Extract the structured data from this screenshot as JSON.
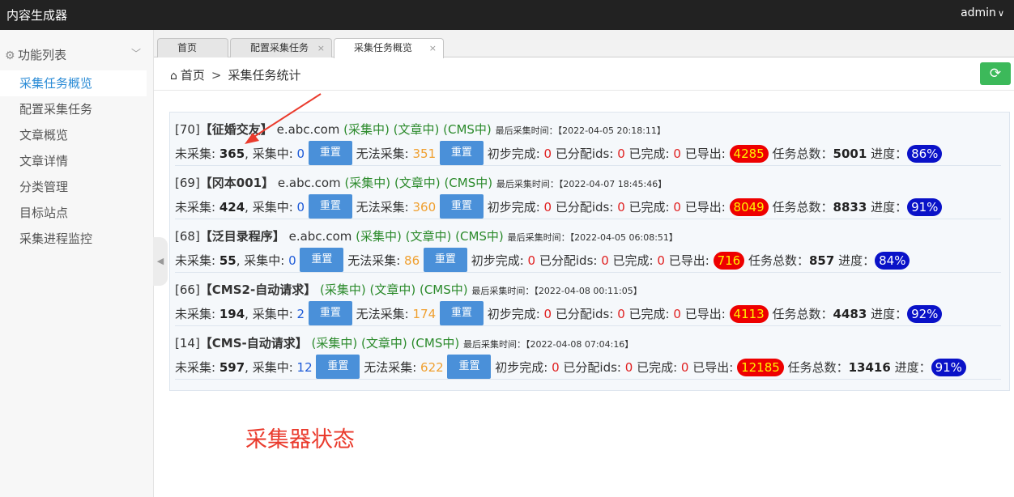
{
  "app": {
    "title": "内容生成器",
    "user": "admin"
  },
  "sidebar": {
    "header": "功能列表",
    "items": [
      {
        "label": "采集任务概览"
      },
      {
        "label": "配置采集任务"
      },
      {
        "label": "文章概览"
      },
      {
        "label": "文章详情"
      },
      {
        "label": "分类管理"
      },
      {
        "label": "目标站点"
      },
      {
        "label": "采集进程监控"
      }
    ]
  },
  "tabs": [
    {
      "label": "首页"
    },
    {
      "label": "配置采集任务",
      "close": "×"
    },
    {
      "label": "采集任务概览",
      "close": "×"
    }
  ],
  "breadcrumb": {
    "home": "首页",
    "sep": ">",
    "current": "采集任务统计"
  },
  "labels": {
    "collecting": "(采集中)",
    "article": "(文章中)",
    "cms": "(CMS中)",
    "last_time": "最后采集时间：",
    "uncollected": "未采集:",
    "in_collect": ", 采集中:",
    "cannot": "无法采集:",
    "prelim": "初步完成:",
    "assigned": "已分配ids:",
    "done": "已完成:",
    "exported": "已导出:",
    "total": "任务总数：",
    "progress": "进度：",
    "reset": "重置"
  },
  "tasks": [
    {
      "id": "[70]",
      "name": "【征婚交友】",
      "site": "e.abc.com",
      "time": "【2022-04-05 20:18:11】",
      "uncollected": "365",
      "collecting": "0",
      "cannot": "351",
      "prelim": "0",
      "assigned": "0",
      "done": "0",
      "exported": "4285",
      "total": "5001",
      "progress": "86%"
    },
    {
      "id": "[69]",
      "name": "【冈本001】",
      "site": "e.abc.com",
      "time": "【2022-04-07 18:45:46】",
      "uncollected": "424",
      "collecting": "0",
      "cannot": "360",
      "prelim": "0",
      "assigned": "0",
      "done": "0",
      "exported": "8049",
      "total": "8833",
      "progress": "91%"
    },
    {
      "id": "[68]",
      "name": "【泛目录程序】",
      "site": "e.abc.com",
      "time": "【2022-04-05 06:08:51】",
      "uncollected": "55",
      "collecting": "0",
      "cannot": "86",
      "prelim": "0",
      "assigned": "0",
      "done": "0",
      "exported": "716",
      "total": "857",
      "progress": "84%"
    },
    {
      "id": "[66]",
      "name": "【CMS2-自动请求】",
      "site": "",
      "time": "【2022-04-08 00:11:05】",
      "uncollected": "194",
      "collecting": "2",
      "cannot": "174",
      "prelim": "0",
      "assigned": "0",
      "done": "0",
      "exported": "4113",
      "total": "4483",
      "progress": "92%"
    },
    {
      "id": "[14]",
      "name": "【CMS-自动请求】",
      "site": "",
      "time": "【2022-04-08 07:04:16】",
      "uncollected": "597",
      "collecting": "12",
      "cannot": "622",
      "prelim": "0",
      "assigned": "0",
      "done": "0",
      "exported": "12185",
      "total": "13416",
      "progress": "91%"
    }
  ],
  "annotation": "采集器状态",
  "icons": {
    "home": "home-icon",
    "gear": "gear-icon",
    "refresh": "refresh-icon"
  },
  "colors": {
    "accent": "#2a8bd6",
    "refresh": "#3cb95a",
    "export_badge": "#ee0000",
    "progress_badge": "#0a12c8",
    "annotation": "#ea3b2d"
  }
}
